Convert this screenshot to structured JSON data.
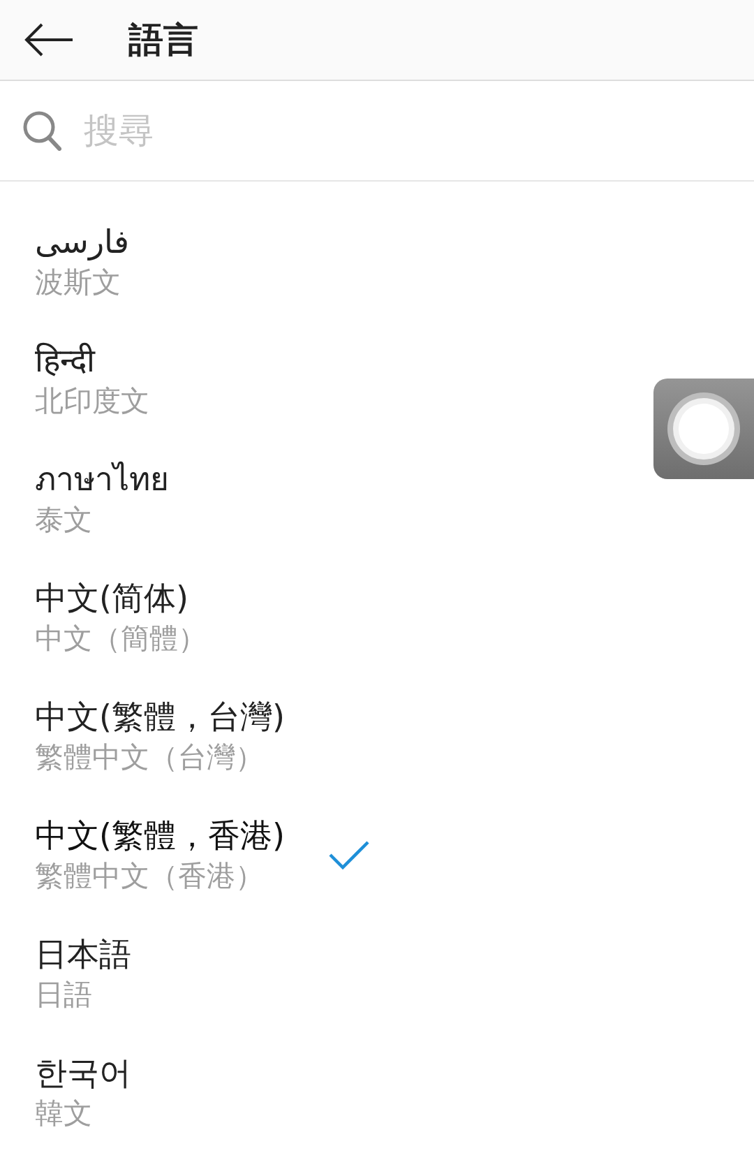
{
  "header": {
    "title": "語言"
  },
  "search": {
    "placeholder": "搜尋"
  },
  "languages": [
    {
      "kind": "full",
      "native": "فارسی",
      "translation": "波斯文",
      "selected": false
    },
    {
      "kind": "full",
      "native": "हिन्दी",
      "translation": "北印度文",
      "selected": false
    },
    {
      "kind": "full",
      "native": "ภาษาไทย",
      "translation": "泰文",
      "selected": false
    },
    {
      "kind": "full",
      "native": "中文(简体)",
      "translation": "中文（簡體）",
      "selected": false
    },
    {
      "kind": "full",
      "native": "中文(繁體，台灣)",
      "translation": "繁體中文（台灣）",
      "selected": false
    },
    {
      "kind": "full",
      "native": "中文(繁體，香港)",
      "translation": "繁體中文（香港）",
      "selected": true
    },
    {
      "kind": "full",
      "native": "日本語",
      "translation": "日語",
      "selected": false
    },
    {
      "kind": "full",
      "native": "한국어",
      "translation": "韓文",
      "selected": false
    }
  ]
}
